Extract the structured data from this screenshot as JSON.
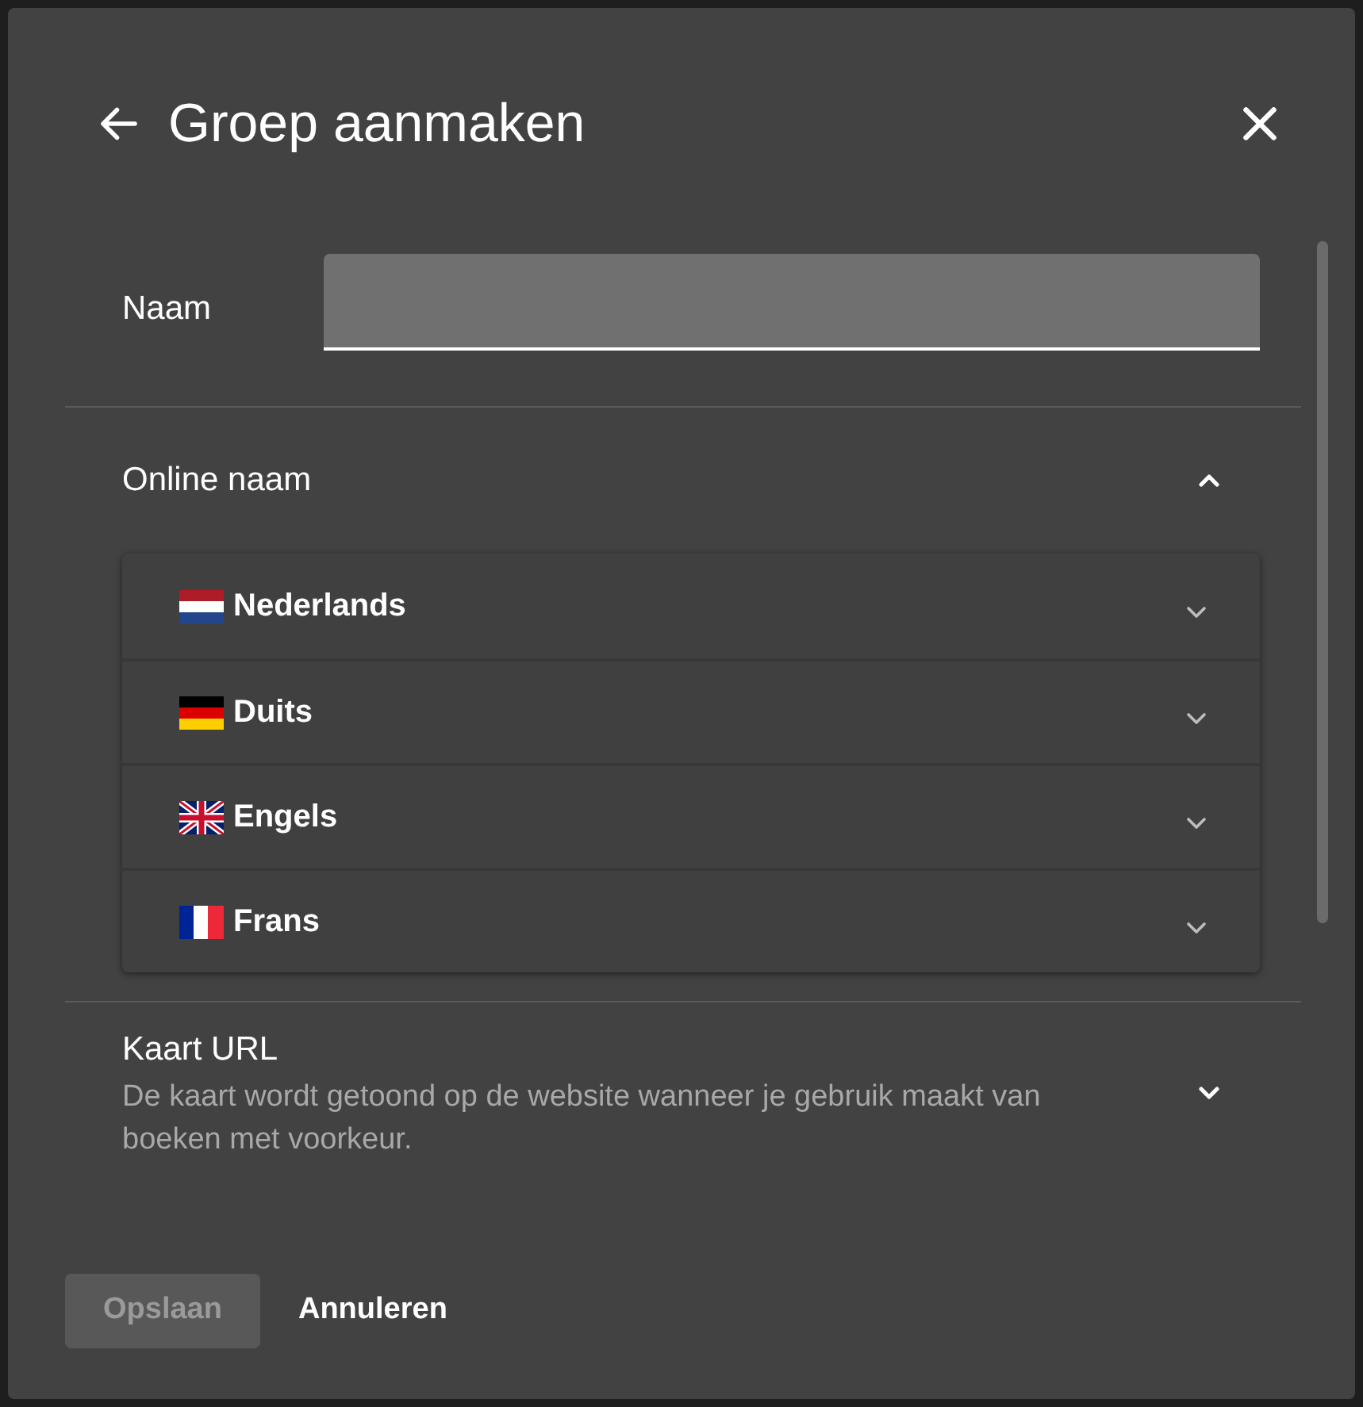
{
  "dialog": {
    "title": "Groep aanmaken"
  },
  "name_field": {
    "label": "Naam"
  },
  "online_name": {
    "label": "Online naam",
    "expanded": true,
    "languages": [
      {
        "kind": "nl",
        "label": "Nederlands",
        "expanded": false
      },
      {
        "kind": "de",
        "label": "Duits",
        "expanded": false
      },
      {
        "kind": "gb",
        "label": "Engels",
        "expanded": false
      },
      {
        "kind": "fr",
        "label": "Frans",
        "expanded": false
      }
    ]
  },
  "map_url": {
    "label": "Kaart URL",
    "description": "De kaart wordt getoond op de website wanneer je gebruik maakt van boeken met voorkeur.",
    "expanded": false
  },
  "buttons": [
    {
      "kind": "primary",
      "label": "Opslaan",
      "disabled": true
    },
    {
      "kind": "text",
      "label": "Annuleren",
      "disabled": false
    }
  ]
}
